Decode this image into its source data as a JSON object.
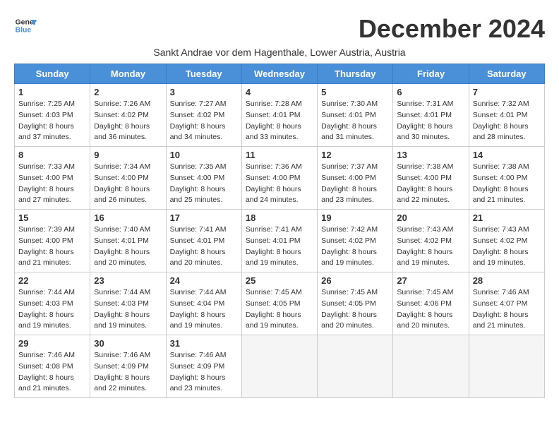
{
  "header": {
    "logo_line1": "General",
    "logo_line2": "Blue",
    "month_title": "December 2024",
    "subtitle": "Sankt Andrae vor dem Hagenthale, Lower Austria, Austria"
  },
  "weekdays": [
    "Sunday",
    "Monday",
    "Tuesday",
    "Wednesday",
    "Thursday",
    "Friday",
    "Saturday"
  ],
  "weeks": [
    [
      {
        "num": "1",
        "sunrise": "7:25 AM",
        "sunset": "4:03 PM",
        "daylight": "8 hours and 37 minutes."
      },
      {
        "num": "2",
        "sunrise": "7:26 AM",
        "sunset": "4:02 PM",
        "daylight": "8 hours and 36 minutes."
      },
      {
        "num": "3",
        "sunrise": "7:27 AM",
        "sunset": "4:02 PM",
        "daylight": "8 hours and 34 minutes."
      },
      {
        "num": "4",
        "sunrise": "7:28 AM",
        "sunset": "4:01 PM",
        "daylight": "8 hours and 33 minutes."
      },
      {
        "num": "5",
        "sunrise": "7:30 AM",
        "sunset": "4:01 PM",
        "daylight": "8 hours and 31 minutes."
      },
      {
        "num": "6",
        "sunrise": "7:31 AM",
        "sunset": "4:01 PM",
        "daylight": "8 hours and 30 minutes."
      },
      {
        "num": "7",
        "sunrise": "7:32 AM",
        "sunset": "4:01 PM",
        "daylight": "8 hours and 28 minutes."
      }
    ],
    [
      {
        "num": "8",
        "sunrise": "7:33 AM",
        "sunset": "4:00 PM",
        "daylight": "8 hours and 27 minutes."
      },
      {
        "num": "9",
        "sunrise": "7:34 AM",
        "sunset": "4:00 PM",
        "daylight": "8 hours and 26 minutes."
      },
      {
        "num": "10",
        "sunrise": "7:35 AM",
        "sunset": "4:00 PM",
        "daylight": "8 hours and 25 minutes."
      },
      {
        "num": "11",
        "sunrise": "7:36 AM",
        "sunset": "4:00 PM",
        "daylight": "8 hours and 24 minutes."
      },
      {
        "num": "12",
        "sunrise": "7:37 AM",
        "sunset": "4:00 PM",
        "daylight": "8 hours and 23 minutes."
      },
      {
        "num": "13",
        "sunrise": "7:38 AM",
        "sunset": "4:00 PM",
        "daylight": "8 hours and 22 minutes."
      },
      {
        "num": "14",
        "sunrise": "7:38 AM",
        "sunset": "4:00 PM",
        "daylight": "8 hours and 21 minutes."
      }
    ],
    [
      {
        "num": "15",
        "sunrise": "7:39 AM",
        "sunset": "4:00 PM",
        "daylight": "8 hours and 21 minutes."
      },
      {
        "num": "16",
        "sunrise": "7:40 AM",
        "sunset": "4:01 PM",
        "daylight": "8 hours and 20 minutes."
      },
      {
        "num": "17",
        "sunrise": "7:41 AM",
        "sunset": "4:01 PM",
        "daylight": "8 hours and 20 minutes."
      },
      {
        "num": "18",
        "sunrise": "7:41 AM",
        "sunset": "4:01 PM",
        "daylight": "8 hours and 19 minutes."
      },
      {
        "num": "19",
        "sunrise": "7:42 AM",
        "sunset": "4:02 PM",
        "daylight": "8 hours and 19 minutes."
      },
      {
        "num": "20",
        "sunrise": "7:43 AM",
        "sunset": "4:02 PM",
        "daylight": "8 hours and 19 minutes."
      },
      {
        "num": "21",
        "sunrise": "7:43 AM",
        "sunset": "4:02 PM",
        "daylight": "8 hours and 19 minutes."
      }
    ],
    [
      {
        "num": "22",
        "sunrise": "7:44 AM",
        "sunset": "4:03 PM",
        "daylight": "8 hours and 19 minutes."
      },
      {
        "num": "23",
        "sunrise": "7:44 AM",
        "sunset": "4:03 PM",
        "daylight": "8 hours and 19 minutes."
      },
      {
        "num": "24",
        "sunrise": "7:44 AM",
        "sunset": "4:04 PM",
        "daylight": "8 hours and 19 minutes."
      },
      {
        "num": "25",
        "sunrise": "7:45 AM",
        "sunset": "4:05 PM",
        "daylight": "8 hours and 19 minutes."
      },
      {
        "num": "26",
        "sunrise": "7:45 AM",
        "sunset": "4:05 PM",
        "daylight": "8 hours and 20 minutes."
      },
      {
        "num": "27",
        "sunrise": "7:45 AM",
        "sunset": "4:06 PM",
        "daylight": "8 hours and 20 minutes."
      },
      {
        "num": "28",
        "sunrise": "7:46 AM",
        "sunset": "4:07 PM",
        "daylight": "8 hours and 21 minutes."
      }
    ],
    [
      {
        "num": "29",
        "sunrise": "7:46 AM",
        "sunset": "4:08 PM",
        "daylight": "8 hours and 21 minutes."
      },
      {
        "num": "30",
        "sunrise": "7:46 AM",
        "sunset": "4:09 PM",
        "daylight": "8 hours and 22 minutes."
      },
      {
        "num": "31",
        "sunrise": "7:46 AM",
        "sunset": "4:09 PM",
        "daylight": "8 hours and 23 minutes."
      },
      null,
      null,
      null,
      null
    ]
  ]
}
